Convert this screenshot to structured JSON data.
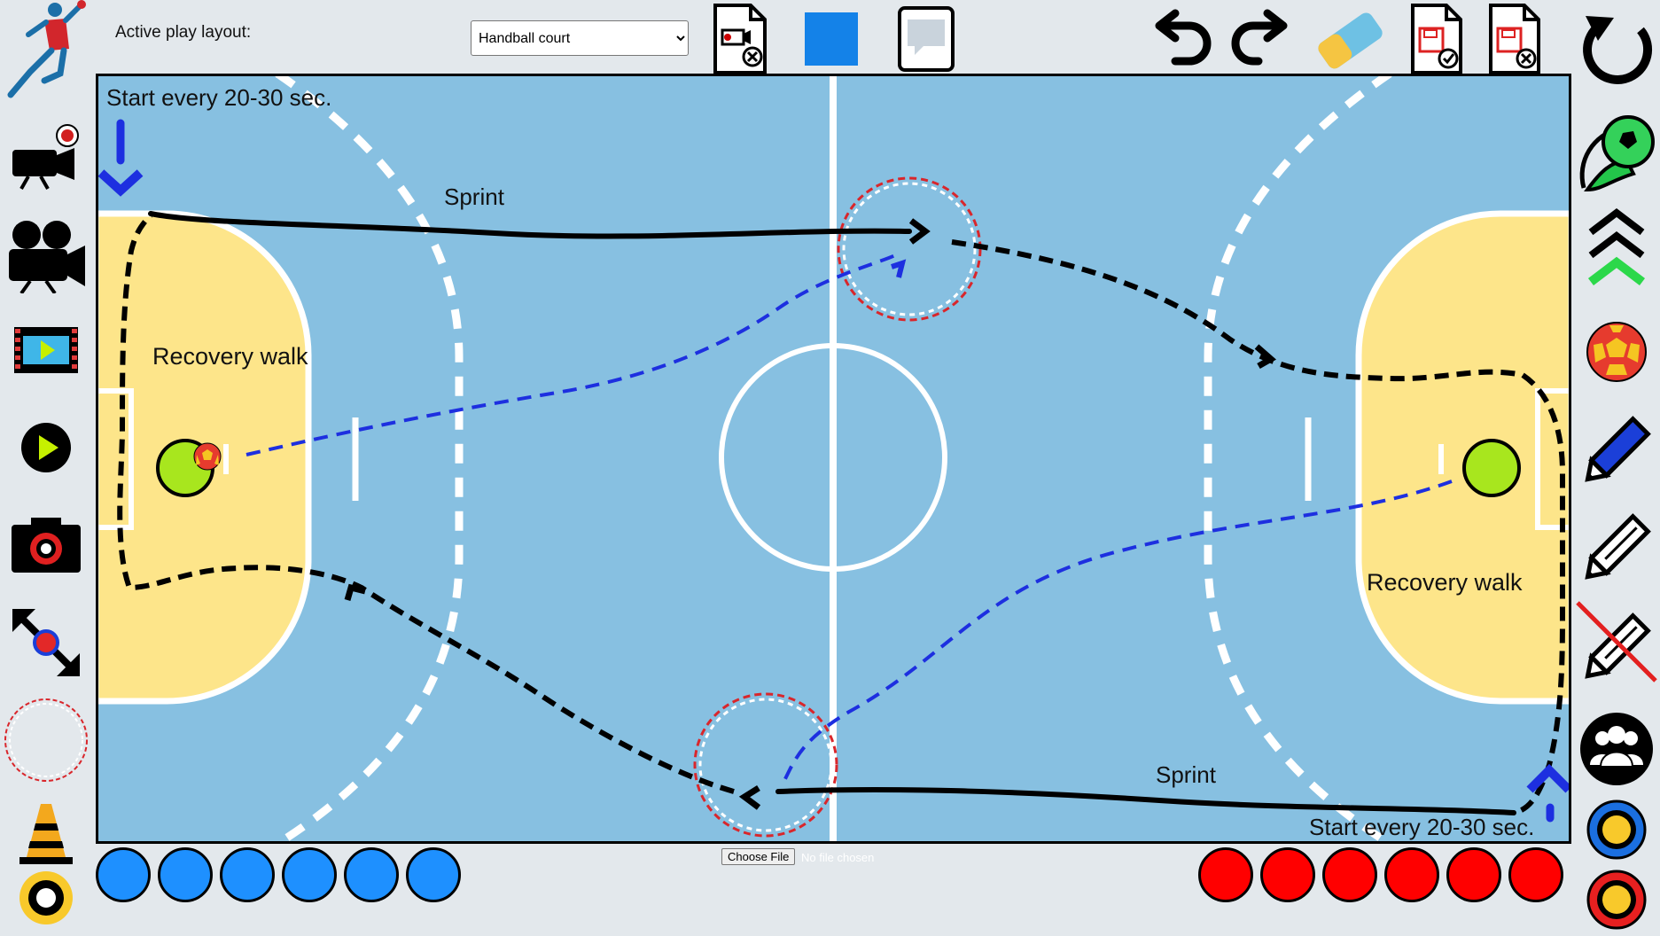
{
  "header": {
    "layout_label": "Active play layout:",
    "layout_select_value": "Handball court",
    "layout_options": [
      "Handball court"
    ]
  },
  "file_input": {
    "button_label": "Choose File",
    "status": "No file chosen"
  },
  "court": {
    "start_note_top": "Start every 20-30 sec.",
    "start_note_bottom": "Start every 20-30 sec.",
    "sprint_top": "Sprint",
    "sprint_bottom": "Sprint",
    "recovery_left": "Recovery walk",
    "recovery_right": "Recovery walk"
  },
  "team_blue": {
    "color": "#1e90ff",
    "count": 6
  },
  "team_red": {
    "color": "#ff0000",
    "count": 6
  },
  "colors": {
    "court_blue": "#87c0e1",
    "goal_area": "#fde58a",
    "line_white": "#ffffff",
    "run_path": "#000000",
    "pass_path": "#1d2fe0",
    "cone_circle": "#d9262b",
    "ball_green": "#a8e61e",
    "selected_color_swatch": "#1482e8"
  },
  "icons": {
    "left_toolbar": [
      "handball-player-logo",
      "record-video-icon",
      "movie-camera-icon",
      "film-strip-icon",
      "play-icon",
      "camera-icon",
      "resize-icon",
      "circle-marker-icon",
      "cone-icon",
      "ring-icon"
    ],
    "right_toolbar": [
      "reset-icon",
      "soccer-ball-icon",
      "chevrons-up-icon",
      "handball-icon",
      "blue-pen-icon",
      "black-pen-icon",
      "erase-pen-icon",
      "team-icon",
      "yellow-blue-ring-icon",
      "yellow-red-ring-icon"
    ],
    "top_toolbar": [
      "delete-recording-icon",
      "color-swatch",
      "speech-bubble-icon",
      "undo-icon",
      "redo-icon",
      "eraser-icon",
      "save-file-icon",
      "delete-file-icon"
    ]
  }
}
